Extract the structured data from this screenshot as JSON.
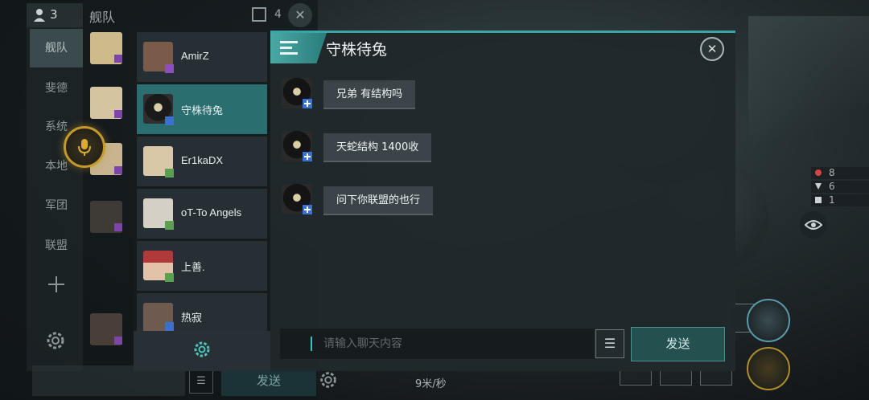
{
  "background": {
    "member_count": "3",
    "fleet_title": "舰队",
    "window_count": "4",
    "channels": [
      "舰队",
      "斐德",
      "系统",
      "本地",
      "军团",
      "联盟"
    ],
    "bottom_send_label": "发送",
    "speed": "9米/秒",
    "hud": [
      {
        "value": "8",
        "color": "#d64545"
      },
      {
        "value": "6",
        "color": "#c9d2d4"
      },
      {
        "value": "1",
        "color": "#c9d2d4"
      }
    ]
  },
  "contacts": [
    {
      "name": "AmirZ",
      "badge_color": "#8e4dc0",
      "avatar_color": "#7a5a48"
    },
    {
      "name": "守株待兔",
      "badge_color": "#3b6fd1",
      "avatar_color": "#2a2a2a"
    },
    {
      "name": "Er1kaDX",
      "badge_color": "#5aa14f",
      "avatar_color": "#d8c8a8"
    },
    {
      "name": "oT-To Angels",
      "badge_color": "#5aa14f",
      "avatar_color": "#d5d0c6"
    },
    {
      "name": "上善.",
      "badge_color": "#5aa14f",
      "avatar_color": "#b03a3a"
    },
    {
      "name": "热寂",
      "badge_color": "#3b6fd1",
      "avatar_color": "#6e5a4e"
    }
  ],
  "chat": {
    "title": "守株待兔",
    "messages": [
      {
        "text": "兄弟 有结构吗"
      },
      {
        "text": "天蛇结构 1400收"
      },
      {
        "text": "问下你联盟的也行"
      }
    ],
    "input_placeholder": "请输入聊天内容",
    "input_value": "",
    "send_label": "发送"
  }
}
